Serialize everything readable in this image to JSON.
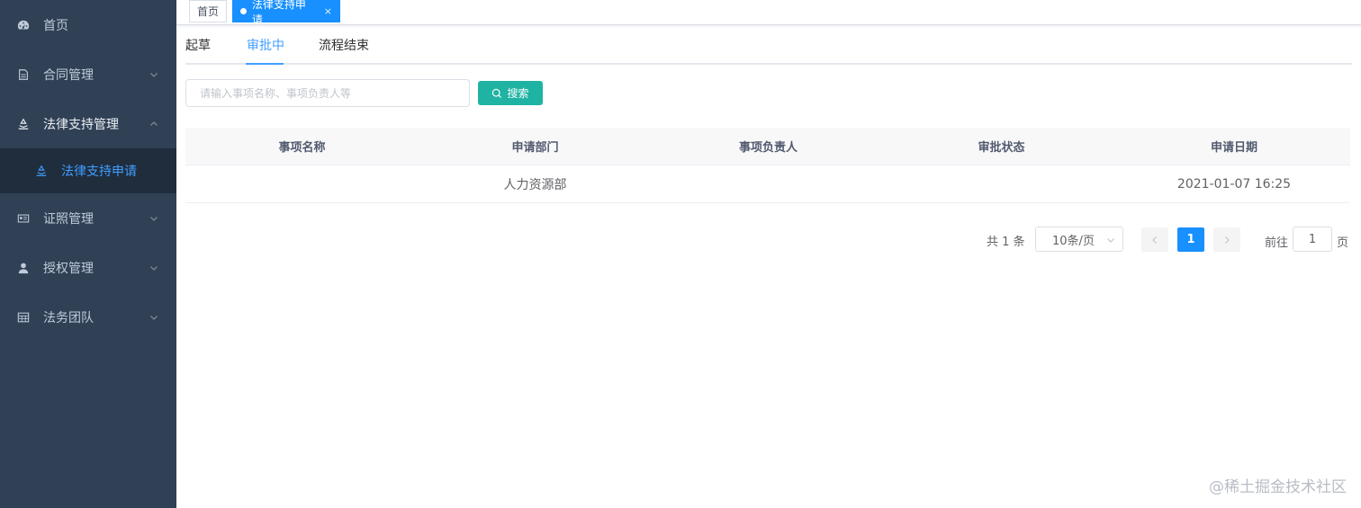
{
  "sidebar": {
    "items": [
      {
        "label": "首页",
        "icon": "dashboard-icon"
      },
      {
        "label": "合同管理",
        "icon": "contract-icon"
      },
      {
        "label": "法律支持管理",
        "icon": "law-scale-icon"
      },
      {
        "label": "证照管理",
        "icon": "id-card-icon"
      },
      {
        "label": "授权管理",
        "icon": "user-icon"
      },
      {
        "label": "法务团队",
        "icon": "table-icon"
      }
    ],
    "sub_items": [
      {
        "label": "法律支持申请",
        "icon": "law-scale-icon"
      }
    ],
    "colors": {
      "background": "#304156",
      "submenu": "#1f2d3d",
      "active": "#409eff"
    }
  },
  "tags_view": {
    "home": "首页",
    "active": "法律支持申请",
    "close": "×"
  },
  "tabs": [
    {
      "label": "起草"
    },
    {
      "label": "审批中"
    },
    {
      "label": "流程结束"
    }
  ],
  "search": {
    "placeholder": "请输入事项名称、事项负责人等",
    "button_label": "搜索"
  },
  "table": {
    "columns": [
      "事项名称",
      "申请部门",
      "事项负责人",
      "审批状态",
      "申请日期"
    ],
    "rows": [
      [
        "",
        "人力资源部",
        "",
        "",
        "2021-01-07 16:25"
      ]
    ]
  },
  "pagination": {
    "total_text": "共 1 条",
    "page_size": "10条/页",
    "current_page": "1",
    "goto_label": "前往",
    "goto_value": "1",
    "page_suffix": "页"
  },
  "watermark": "@稀土掘金技术社区"
}
